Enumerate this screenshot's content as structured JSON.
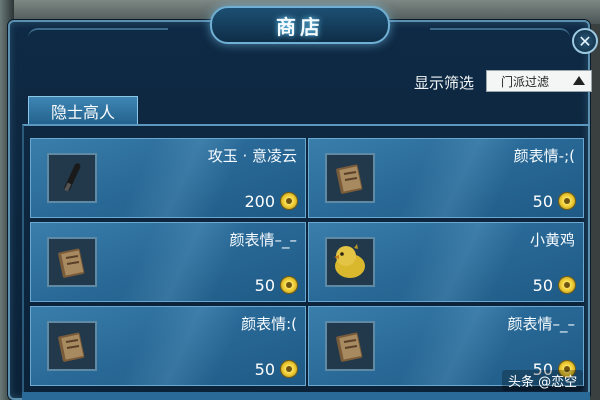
{
  "window": {
    "title": "商店",
    "close_label": "✕"
  },
  "filter": {
    "label": "显示筛选",
    "selected": "门派过滤"
  },
  "tab": {
    "label": "隐士高人"
  },
  "items": [
    {
      "name": "攻玉 · 意凌云",
      "price": "200",
      "icon": "brush-icon"
    },
    {
      "name": "颜表情-;(",
      "price": "50",
      "icon": "book-icon"
    },
    {
      "name": "颜表情–_–",
      "price": "50",
      "icon": "book-icon"
    },
    {
      "name": "小黄鸡",
      "price": "50",
      "icon": "chick-icon"
    },
    {
      "name": "颜表情:(",
      "price": "50",
      "icon": "book-icon"
    },
    {
      "name": "颜表情–_–",
      "price": "50",
      "icon": "book-icon"
    }
  ],
  "currency": {
    "icon": "coin-icon",
    "color": "#f3d33a"
  },
  "watermark": "头条 @恋空"
}
